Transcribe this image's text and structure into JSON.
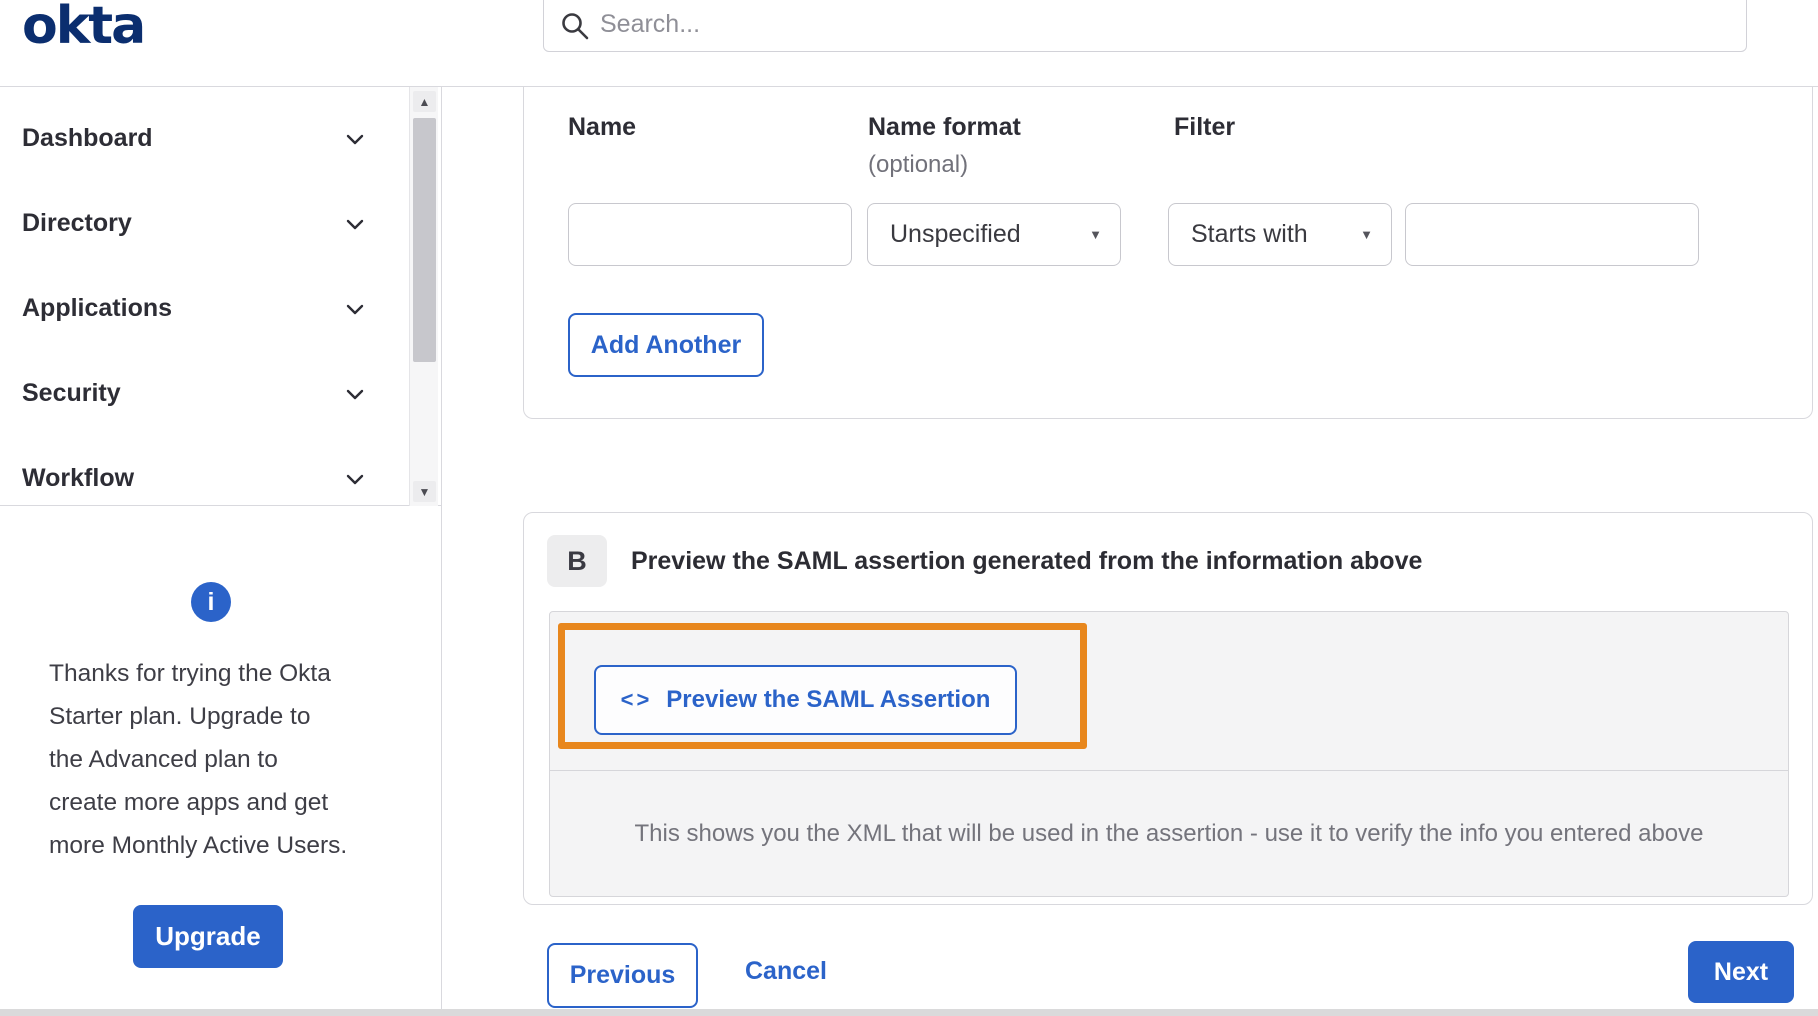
{
  "brand": {
    "logo": "okta"
  },
  "header": {
    "search_placeholder": "Search..."
  },
  "sidebar": {
    "items": [
      {
        "label": "Dashboard"
      },
      {
        "label": "Directory"
      },
      {
        "label": "Applications"
      },
      {
        "label": "Security"
      },
      {
        "label": "Workflow"
      }
    ],
    "upsell": {
      "lines": [
        "Thanks for trying the Okta",
        "Starter plan. Upgrade to",
        "the Advanced plan to",
        "create more apps and get",
        "more Monthly Active Users."
      ],
      "upgrade_label": "Upgrade"
    }
  },
  "form": {
    "name_label": "Name",
    "name_format_label": "Name format",
    "name_format_sublabel": "(optional)",
    "filter_label": "Filter",
    "name_value": "",
    "name_format_value": "Unspecified",
    "filter_operator_value": "Starts with",
    "filter_value": "",
    "add_another_label": "Add Another"
  },
  "preview": {
    "badge": "B",
    "title": "Preview the SAML assertion generated from the information above",
    "button_label": "Preview the SAML Assertion",
    "description": "This shows you the XML that will be used in the assertion - use it to verify the info you entered above"
  },
  "wizard": {
    "previous_label": "Previous",
    "cancel_label": "Cancel",
    "next_label": "Next"
  },
  "icons": {
    "search": "magnifier",
    "sidebar_chevron": "chevron-down",
    "select_arrow": "▼",
    "scroll_up": "▲",
    "scroll_down": "▼",
    "info": "i",
    "code": "<>"
  },
  "colors": {
    "accent_blue": "#2b63c9",
    "brand_navy": "#0b2e6f",
    "highlight_orange": "#e8871d"
  }
}
